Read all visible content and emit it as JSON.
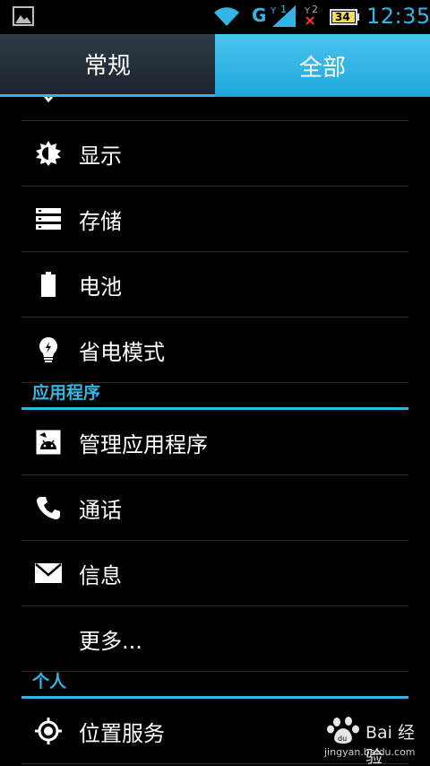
{
  "status_bar": {
    "network_type": "G",
    "sim1_label": "1",
    "sim2_label": "2",
    "battery_level": "34",
    "time": "12:35"
  },
  "tabs": [
    {
      "label": "常规",
      "active": false
    },
    {
      "label": "全部",
      "active": true
    }
  ],
  "list": {
    "row_display": "显示",
    "row_storage": "存储",
    "row_battery": "电池",
    "row_power_saving": "省电模式",
    "section_apps": "应用程序",
    "row_manage_apps": "管理应用程序",
    "row_call": "通话",
    "row_messages": "信息",
    "row_more": "更多...",
    "section_personal": "个人",
    "row_location": "位置服务"
  },
  "watermark": {
    "brand": "Bai 经验",
    "url": "jingyan.baidu.com"
  },
  "colors": {
    "accent": "#33b5e5",
    "background": "#000000"
  }
}
